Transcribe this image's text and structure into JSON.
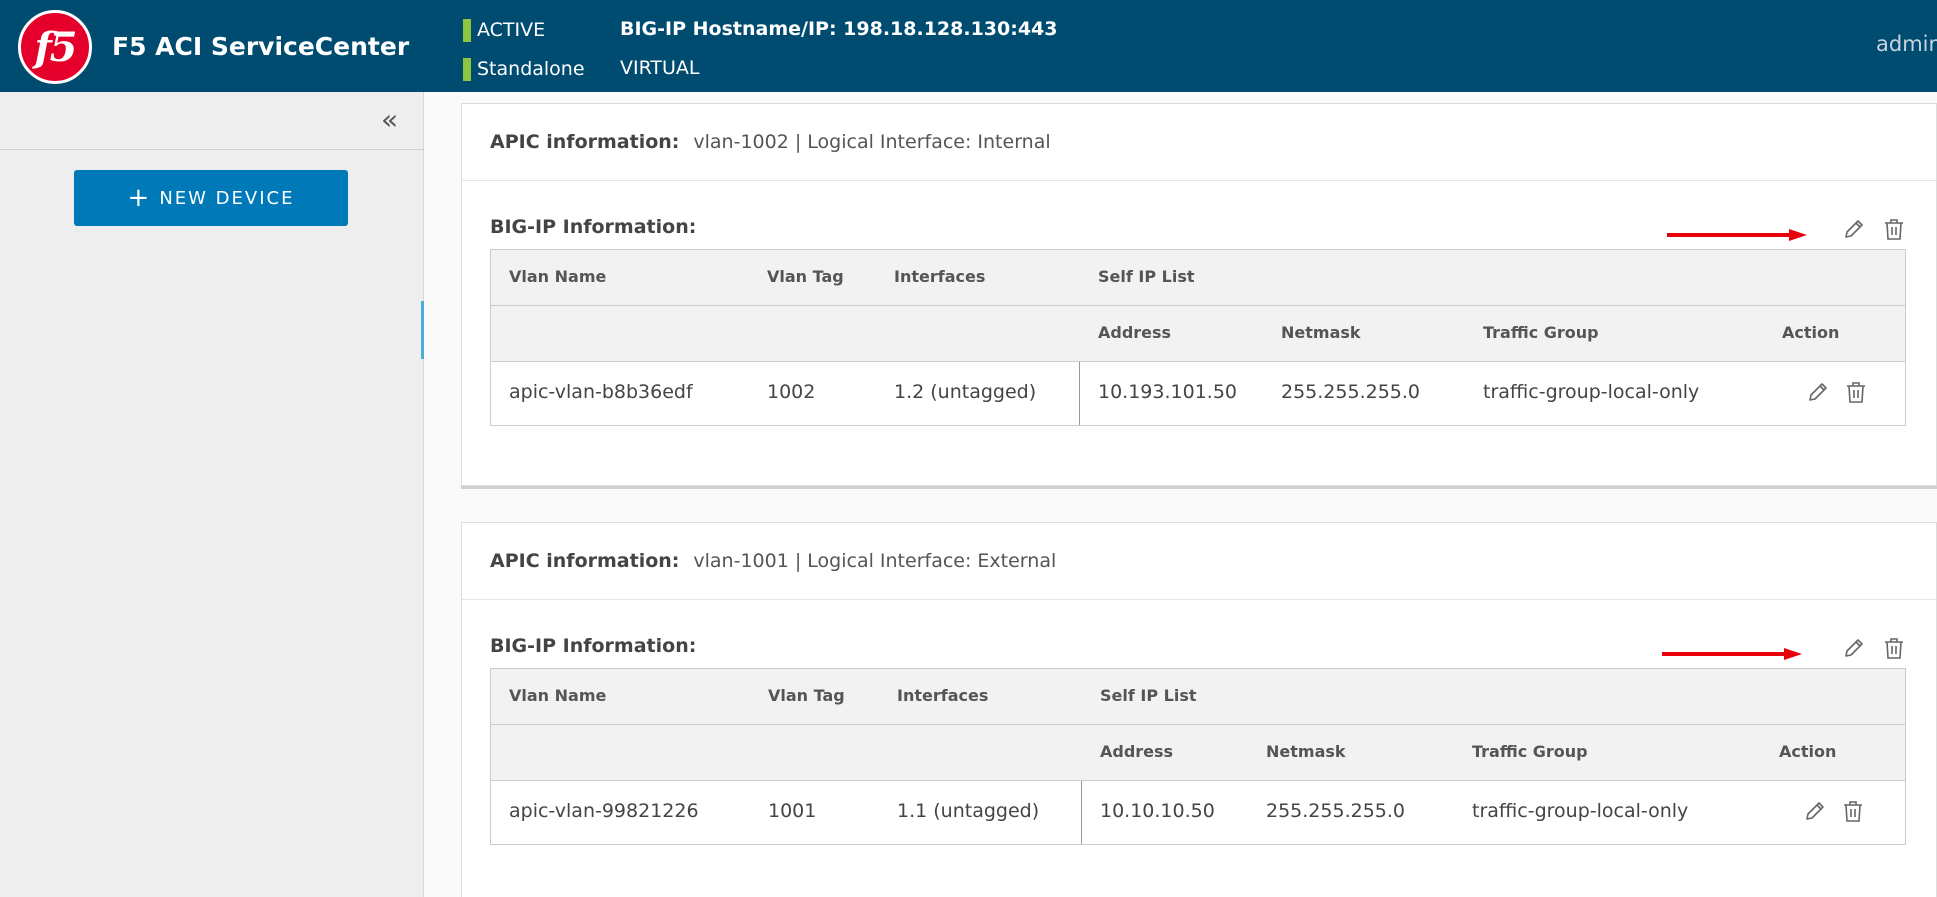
{
  "header": {
    "logo_text": "f5",
    "app_title": "F5 ACI ServiceCenter",
    "status_1": "ACTIVE",
    "status_2": "Standalone",
    "hostname": "BIG-IP Hostname/IP: 198.18.128.130:443",
    "mode": "VIRTUAL",
    "user": "admin",
    "status_color": "#8cc63f",
    "bar_color": "#004c70"
  },
  "sidebar": {
    "collapse_icon": "double-chevron-left-icon",
    "collapse_glyph": "«",
    "new_device_plus": "+",
    "new_device_label": "NEW DEVICE",
    "button_color": "#0079b8"
  },
  "labels": {
    "apic_label": "APIC information:",
    "bigip_label": "BIG-IP Information:"
  },
  "table_headers": {
    "vlan_name": "Vlan Name",
    "vlan_tag": "Vlan Tag",
    "interfaces": "Interfaces",
    "self_ip_list": "Self IP List",
    "address": "Address",
    "netmask": "Netmask",
    "traffic_group": "Traffic Group",
    "action": "Action"
  },
  "cards": [
    {
      "apic_value": "vlan-1002 | Logical Interface: Internal",
      "row": {
        "vlan_name": "apic-vlan-b8b36edf",
        "vlan_tag": "1002",
        "interfaces": "1.2 (untagged)",
        "address": "10.193.101.50",
        "netmask": "255.255.255.0",
        "traffic_group": "traffic-group-local-only"
      }
    },
    {
      "apic_value": "vlan-1001 | Logical Interface: External",
      "row": {
        "vlan_name": "apic-vlan-99821226",
        "vlan_tag": "1001",
        "interfaces": "1.1 (untagged)",
        "address": "10.10.10.50",
        "netmask": "255.255.255.0",
        "traffic_group": "traffic-group-local-only"
      }
    }
  ],
  "annotation_color": "#e8000b"
}
